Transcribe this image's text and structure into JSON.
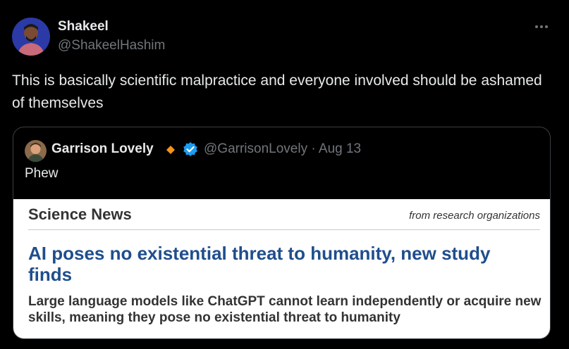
{
  "author": {
    "name": "Shakeel",
    "handle": "@ShakeelHashim"
  },
  "tweet": {
    "text": "This is basically scientific malpractice and everyone involved should be ashamed of themselves"
  },
  "quoted": {
    "name": "Garrison Lovely",
    "meta": "@GarrisonLovely · Aug 13",
    "text": "Phew",
    "media": {
      "publication": "Science News",
      "byline": "from research organizations",
      "headline": "AI poses no existential threat to humanity, new study finds",
      "subheadline": "Large language models like ChatGPT cannot learn independently or acquire new skills, meaning they pose no existential threat to humanity"
    }
  },
  "icons": {
    "more": "more-horizontal-icon",
    "diamond": "orange-diamond-icon",
    "verified": "verified-badge-icon"
  },
  "colors": {
    "background": "#000000",
    "text": "#e7e9ea",
    "muted": "#71767b",
    "verified": "#1d9bf0",
    "diamond": "#f7931a",
    "headline_blue": "#1f4e8c"
  }
}
